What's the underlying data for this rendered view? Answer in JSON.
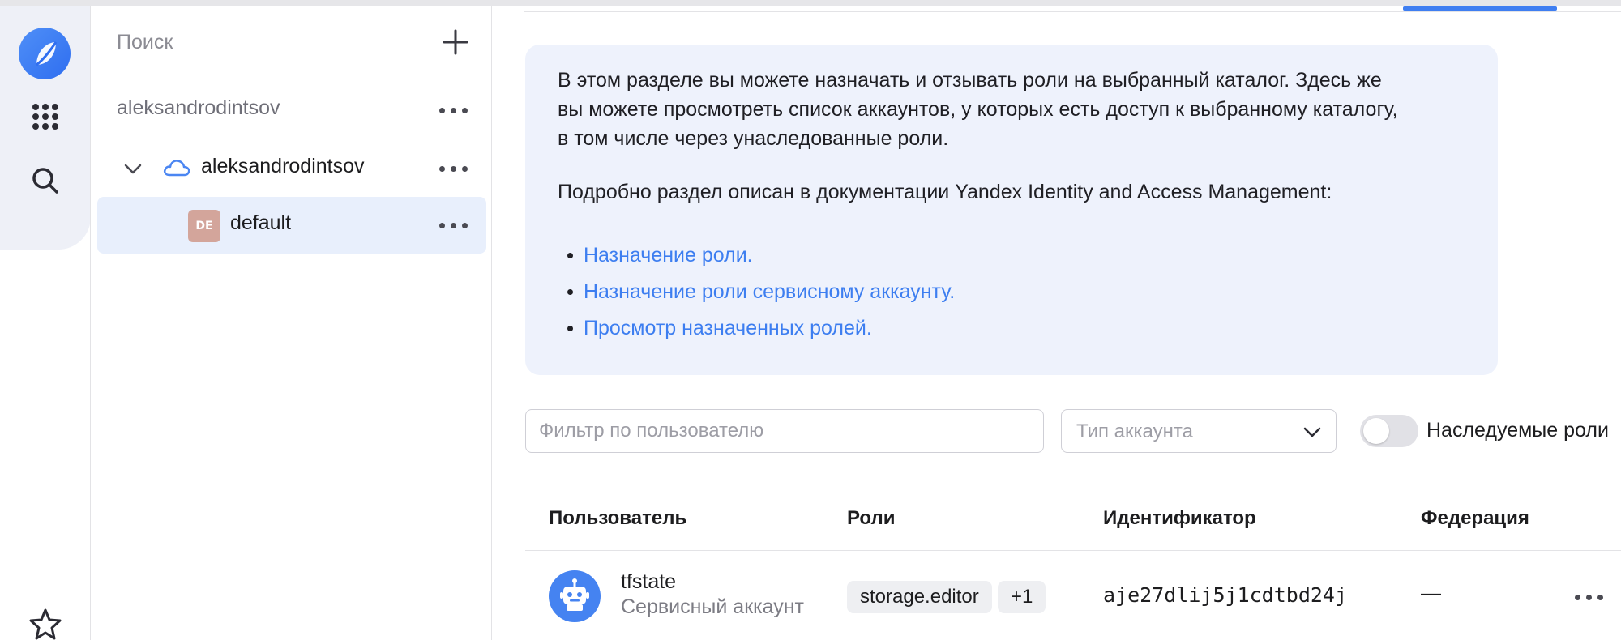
{
  "colors": {
    "accent": "#3f7ef1",
    "link": "#3d7ef0",
    "selected_row": "#e8effc",
    "info_bg": "#eef2fc",
    "default_badge": "#d3a59b",
    "avatar": "#4583f1"
  },
  "rail": {
    "logo_icon": "cloud-logo-icon",
    "items": [
      {
        "name": "apps-grid-icon"
      },
      {
        "name": "search-icon"
      },
      {
        "name": "star-icon"
      }
    ]
  },
  "tree": {
    "search_placeholder": "Поиск",
    "add_icon": "plus-icon",
    "organization": "aleksandrodintsov",
    "cloud": "aleksandrodintsov",
    "folder": "default",
    "folder_badge": "DE"
  },
  "info": {
    "paragraph_1_line_1": "В этом разделе вы можете назначать и отзывать роли на выбранный каталог. Здесь же",
    "paragraph_1_line_2": "вы можете просмотреть список аккаунтов, у которых есть доступ к выбранному каталогу,",
    "paragraph_1_line_3": "в том числе через унаследованные роли.",
    "paragraph_2": "Подробно раздел описан в документации Yandex Identity and Access Management:",
    "links": [
      "Назначение роли.",
      "Назначение роли сервисному аккаунту.",
      "Просмотр назначенных ролей."
    ]
  },
  "filters": {
    "user_filter_placeholder": "Фильтр по пользователю",
    "account_type_placeholder": "Тип аккаунта",
    "inherited_roles_label": "Наследуемые роли",
    "inherited_roles_enabled": false
  },
  "table": {
    "headers": [
      "Пользователь",
      "Роли",
      "Идентификатор",
      "Федерация"
    ],
    "rows": [
      {
        "name": "tfstate",
        "type": "Сервисный аккаунт",
        "role": "storage.editor",
        "more_roles": "+1",
        "id": "aje27dlij5j1cdtbd24j",
        "federation": "—"
      }
    ]
  }
}
